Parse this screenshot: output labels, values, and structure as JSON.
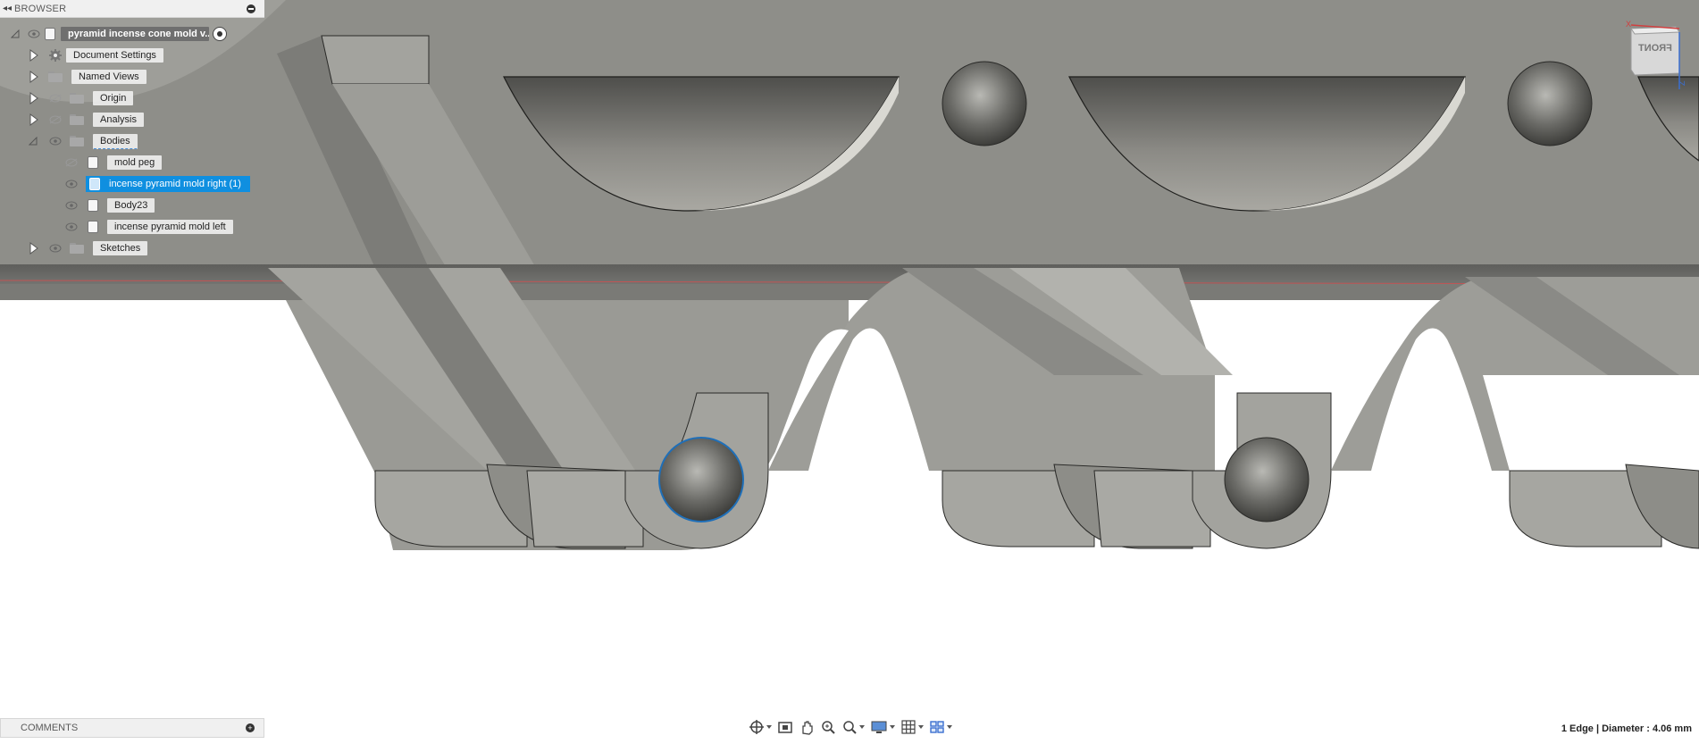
{
  "browser": {
    "title": "BROWSER",
    "root_label": "pyramid incense cone mold v...",
    "items": [
      {
        "label": "Document Settings"
      },
      {
        "label": "Named Views"
      },
      {
        "label": "Origin"
      },
      {
        "label": "Analysis"
      },
      {
        "label": "Bodies"
      },
      {
        "label": "mold peg"
      },
      {
        "label": "incense pyramid mold right (1)"
      },
      {
        "label": "Body23"
      },
      {
        "label": "incense pyramid mold left"
      },
      {
        "label": "Sketches"
      }
    ]
  },
  "comments": {
    "title": "COMMENTS"
  },
  "toolbar": {
    "icons": [
      "orbit-icon",
      "look-at-icon",
      "pan-icon",
      "zoom-icon",
      "fit-icon",
      "display-settings-icon",
      "grid-settings-icon",
      "viewports-icon"
    ]
  },
  "status": {
    "selection": "1 Edge | Diameter : 4.06 mm"
  },
  "viewcube": {
    "face_label": "FRONT"
  },
  "colors": {
    "model_light": "#a3a39e",
    "model_dark": "#6d6d69",
    "selection": "#0f8fe0",
    "panel": "#f0f0f0"
  }
}
